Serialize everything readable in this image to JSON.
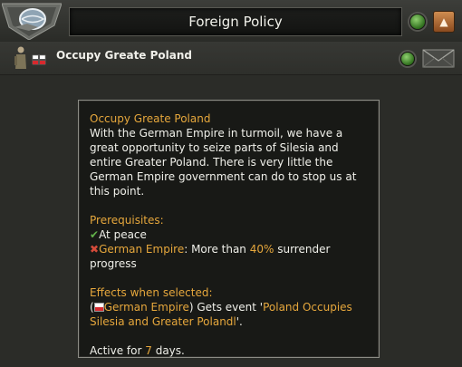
{
  "header": {
    "title": "Foreign Policy",
    "collapse_symbol": "▲"
  },
  "row": {
    "label": "Occupy Greate Poland"
  },
  "tooltip": {
    "title": "Occupy Greate Poland",
    "description": "With the German Empire in turmoil, we have a great opportunity to seize parts of Silesia and entire Greater Poland. There is very little the German Empire government can do to stop us at this point.",
    "prereq_heading": "Prerequisites:",
    "prereq_1_mark": "✔",
    "prereq_1_text": "At peace",
    "prereq_2_mark": "✖",
    "prereq_2_country": "German Empire",
    "prereq_2_text_a": ": More than ",
    "prereq_2_value": "40%",
    "prereq_2_text_b": " surrender progress",
    "effects_heading": "Effects when selected:",
    "effect_open_paren": "(",
    "effect_country": "German Empire",
    "effect_text_a": ") Gets event '",
    "effect_event": "Poland Occupies Silesia and Greater Polandl",
    "effect_text_b": "'.",
    "active_text_a": "Active for ",
    "active_days": "7",
    "active_text_b": " days."
  },
  "colors": {
    "gold": "#e6a73c",
    "check_green": "#62b14a",
    "cross_red": "#d64b3a",
    "status_green": "#5fae3f"
  },
  "icons": [
    "globe-emblem-icon",
    "status-indicator-icon",
    "collapse-arrow-icon",
    "soldier-flag-icon",
    "mail-envelope-icon",
    "checkmark-icon",
    "cross-icon",
    "poland-flag-icon"
  ]
}
